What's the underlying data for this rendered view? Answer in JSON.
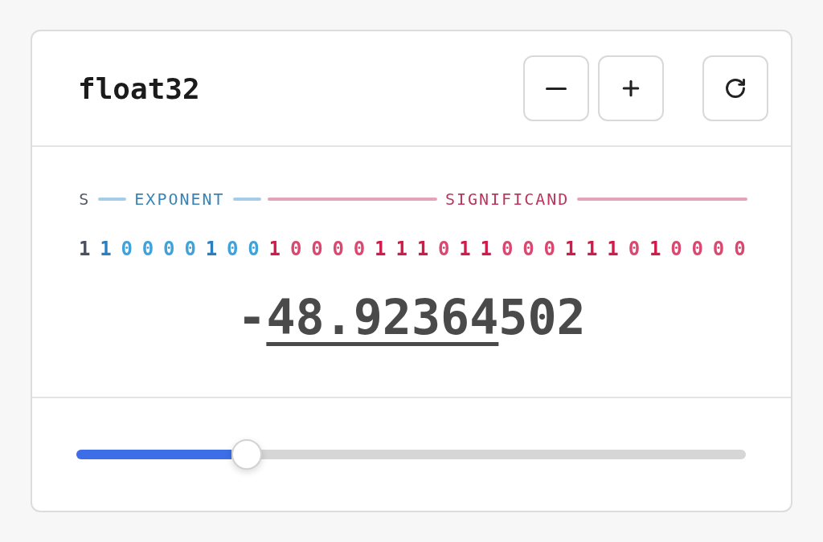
{
  "title": "float32",
  "fields": [
    {
      "kind": "sign",
      "label": "S",
      "bits": [
        {
          "digit": "1",
          "on": true
        }
      ]
    },
    {
      "kind": "exponent",
      "label": "EXPONENT",
      "bits": [
        {
          "digit": "1",
          "on": true
        },
        {
          "digit": "0",
          "on": false
        },
        {
          "digit": "0",
          "on": false
        },
        {
          "digit": "0",
          "on": false
        },
        {
          "digit": "0",
          "on": false
        },
        {
          "digit": "1",
          "on": true
        },
        {
          "digit": "0",
          "on": false
        },
        {
          "digit": "0",
          "on": false
        }
      ]
    },
    {
      "kind": "significand",
      "label": "SIGNIFICAND",
      "bits": [
        {
          "digit": "1",
          "on": true
        },
        {
          "digit": "0",
          "on": false
        },
        {
          "digit": "0",
          "on": false
        },
        {
          "digit": "0",
          "on": false
        },
        {
          "digit": "0",
          "on": false
        },
        {
          "digit": "1",
          "on": true
        },
        {
          "digit": "1",
          "on": true
        },
        {
          "digit": "1",
          "on": true
        },
        {
          "digit": "0",
          "on": false
        },
        {
          "digit": "1",
          "on": true
        },
        {
          "digit": "1",
          "on": true
        },
        {
          "digit": "0",
          "on": false
        },
        {
          "digit": "0",
          "on": false
        },
        {
          "digit": "0",
          "on": false
        },
        {
          "digit": "1",
          "on": true
        },
        {
          "digit": "1",
          "on": true
        },
        {
          "digit": "1",
          "on": true
        },
        {
          "digit": "0",
          "on": false
        },
        {
          "digit": "1",
          "on": true
        },
        {
          "digit": "0",
          "on": false
        },
        {
          "digit": "0",
          "on": false
        },
        {
          "digit": "0",
          "on": false
        },
        {
          "digit": "0",
          "on": false
        }
      ]
    }
  ],
  "value": [
    {
      "text": "-",
      "underlined": false
    },
    {
      "text": "48.92364",
      "underlined": true
    },
    {
      "text": "502",
      "underlined": false
    }
  ],
  "slider": {
    "level": 0.255
  }
}
